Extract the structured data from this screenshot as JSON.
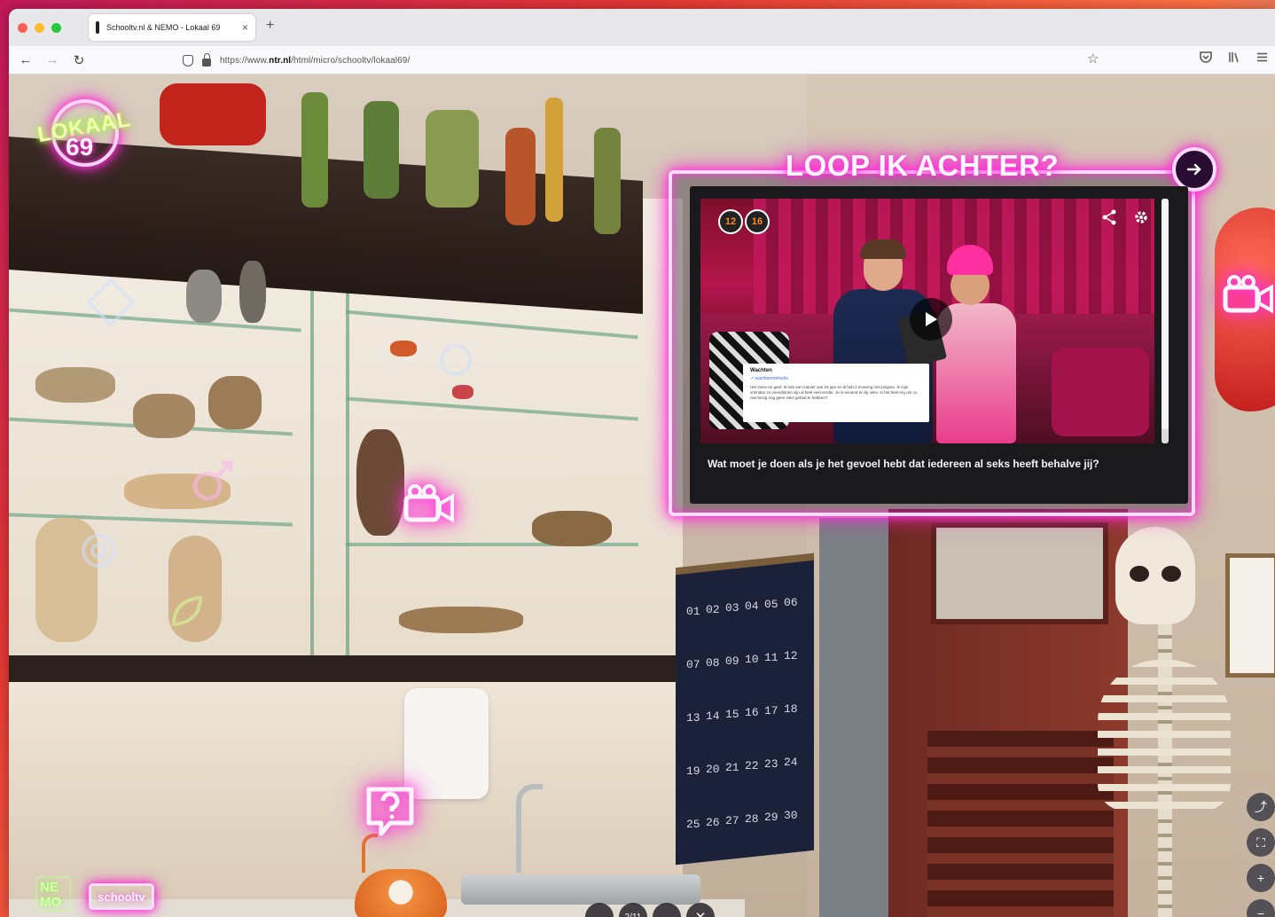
{
  "browser": {
    "tab_title": "Schooltv.nl & NEMO - Lokaal 69",
    "tab_close": "×",
    "new_tab": "+",
    "back": "←",
    "forward": "→",
    "reload": "↻",
    "url_prefix": "https://www.",
    "url_domain": "ntr.nl",
    "url_path": "/html/micro/schooltv/lokaal69/",
    "bookmark": "☆"
  },
  "logo": {
    "word": "LOKAAL",
    "number": "69"
  },
  "panel": {
    "title": "LOOP IK ACHTER?",
    "next_symbol": "→",
    "age_badges": [
      "12",
      "16"
    ],
    "card": {
      "title": "Wachten",
      "link": "↗ wachtenmetseks",
      "text": "Het ziene en geef. Ik heb een manier van 16 jaar en ik heb 2 ervaring met pingme. Ik mijn vrienden ze vriendinnen zijn al heel veel verder. Je is iemand en bij seks. Is het heel erg om zo niet bezig nog geen seks gehad te hebben?"
    },
    "caption": "Wat moet je doen als je het gevoel hebt dat iedereen al seks heeft behalve jij?"
  },
  "calendar_days": [
    "01",
    "02",
    "03",
    "04",
    "05",
    "06",
    "07",
    "08",
    "09",
    "10",
    "11",
    "12",
    "13",
    "14",
    "15",
    "16",
    "17",
    "18",
    "19",
    "20",
    "21",
    "22",
    "23",
    "24",
    "25",
    "26",
    "27",
    "28",
    "29",
    "30"
  ],
  "bottom": {
    "logo_nemo": "NE MO",
    "logo_schooltv": "schooltv",
    "prev": "←",
    "counter": "2/11",
    "next": "→",
    "close": "✕"
  },
  "tools": {
    "share": "⤴",
    "fullscreen": "⛶",
    "zoom_in": "+",
    "zoom_out": "−"
  },
  "colors": {
    "neon_pink": "#ff3ae0",
    "neon_green": "#b8ff3a",
    "panel_bg": "#1a1a1c"
  }
}
